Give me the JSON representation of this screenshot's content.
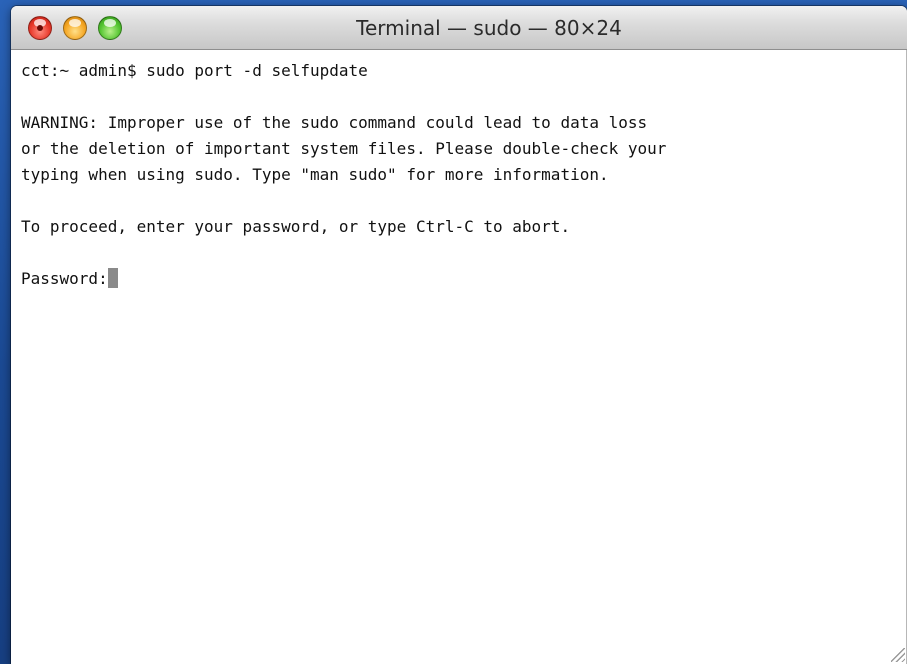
{
  "window": {
    "title": "Terminal — sudo — 80×24",
    "colors": {
      "close": "#e8382a",
      "minimize": "#f5a623",
      "zoom": "#52c42f",
      "background": "#ffffff",
      "text": "#111111",
      "cursor": "#8a8a8a"
    }
  },
  "terminal": {
    "lines": [
      "cct:~ admin$ sudo port -d selfupdate",
      "",
      "WARNING: Improper use of the sudo command could lead to data loss",
      "or the deletion of important system files. Please double-check your",
      "typing when using sudo. Type \"man sudo\" for more information.",
      "",
      "To proceed, enter your password, or type Ctrl-C to abort.",
      ""
    ],
    "prompt": "Password:"
  }
}
